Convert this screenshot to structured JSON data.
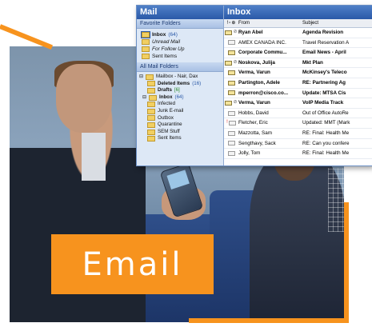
{
  "colors": {
    "accent": "#f7931e",
    "outlook_header": "#2a59a8",
    "pane_bg": "#dde8f6"
  },
  "overlay": {
    "label": "Email"
  },
  "left_pane": {
    "header": "Mail",
    "favorites_header": "Favorite Folders",
    "favorites": [
      {
        "label": "Inbox",
        "count": "(64)",
        "bold": true
      },
      {
        "label": "Unread Mail",
        "italic": true
      },
      {
        "label": "For Follow Up",
        "italic": true
      },
      {
        "label": "Sent Items"
      }
    ],
    "all_header": "All Mail Folders",
    "tree": [
      {
        "label": "Mailbox - Nair, Dax",
        "indent": 0,
        "icon": "mailbox-icon"
      },
      {
        "label": "Deleted Items",
        "count": "(16)",
        "indent": 1,
        "bold": true,
        "icon": "deleted-items-icon"
      },
      {
        "label": "Drafts",
        "count": "[6]",
        "indent": 1,
        "bold": true,
        "icon": "drafts-icon"
      },
      {
        "label": "Inbox",
        "count": "(64)",
        "indent": 1,
        "bold": true,
        "icon": "inbox-icon"
      },
      {
        "label": "Infected",
        "indent": 1,
        "icon": "folder-icon"
      },
      {
        "label": "Junk E-mail",
        "indent": 1,
        "icon": "junk-icon"
      },
      {
        "label": "Outbox",
        "indent": 1,
        "icon": "outbox-icon"
      },
      {
        "label": "Quarantine",
        "indent": 1,
        "icon": "folder-icon"
      },
      {
        "label": "SEM Stuff",
        "indent": 1,
        "icon": "folder-icon"
      },
      {
        "label": "Sent Items",
        "indent": 1,
        "icon": "folder-icon"
      }
    ]
  },
  "inbox": {
    "header": "Inbox",
    "col_from": "From",
    "col_subject": "Subject",
    "rows": [
      {
        "from": "Ryan Abel",
        "subject": "Agenda Revision",
        "unread": true,
        "clip": true
      },
      {
        "from": "AMEX CANADA INC.",
        "subject": "Travel Reservation A",
        "unread": false
      },
      {
        "from": "Corporate Commu...",
        "subject": "Email News - April",
        "unread": true
      },
      {
        "from": "Noskova, Julija",
        "subject": "Mkt Plan",
        "unread": true,
        "clip": true
      },
      {
        "from": "Verma, Varun",
        "subject": "McKinsey's Teleco",
        "unread": true
      },
      {
        "from": "Partington, Adele",
        "subject": "RE: Partnering Ag",
        "unread": true
      },
      {
        "from": "mperron@cisco.co...",
        "subject": "Update: MTSA Cis",
        "unread": true
      },
      {
        "from": "Verma, Varun",
        "subject": "VoIP Media Track",
        "unread": true,
        "clip": true
      },
      {
        "from": "Hobbs, David",
        "subject": "Out of Office AutoRe",
        "unread": false
      },
      {
        "from": "Fletcher, Eric",
        "subject": "Updated: MMT (Mark",
        "unread": false,
        "flag": true
      },
      {
        "from": "Mazzotta, Sam",
        "subject": "RE: Final: Health Me",
        "unread": false
      },
      {
        "from": "Sengthavy, Sack",
        "subject": "RE: Can you confere",
        "unread": false
      },
      {
        "from": "Jolly, Tom",
        "subject": "RE: Final: Health Me",
        "unread": false
      }
    ]
  }
}
